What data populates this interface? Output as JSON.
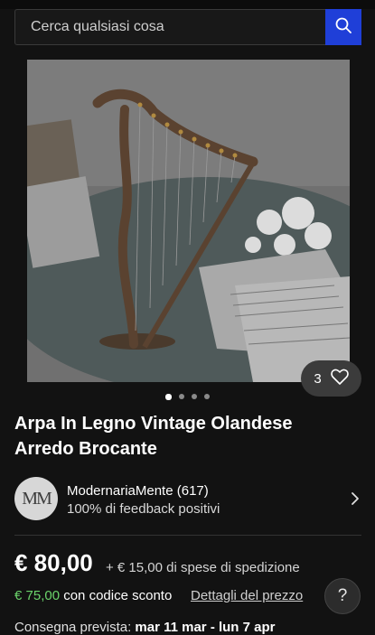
{
  "search": {
    "placeholder": "Cerca qualsiasi cosa"
  },
  "gallery": {
    "save_count": "3",
    "dots": 4,
    "active_dot": 0
  },
  "item": {
    "title": "Arpa In Legno Vintage Olandese Arredo Brocante"
  },
  "seller": {
    "avatar_initials": "MM",
    "name": "ModernariaMente (617)",
    "feedback": "100% di feedback positivi"
  },
  "pricing": {
    "price": "€ 80,00",
    "shipping": "+ € 15,00 di spese di spedizione",
    "coupon_price": "€ 75,00",
    "coupon_text": "con codice sconto",
    "details_link": "Dettagli del prezzo",
    "help": "?"
  },
  "delivery": {
    "label": "Consegna prevista:",
    "dates": "mar 11 mar - lun 7 apr"
  },
  "colors": {
    "background": "#121212",
    "search_button": "#1f3fd8",
    "coupon_green": "#6bd46b"
  }
}
